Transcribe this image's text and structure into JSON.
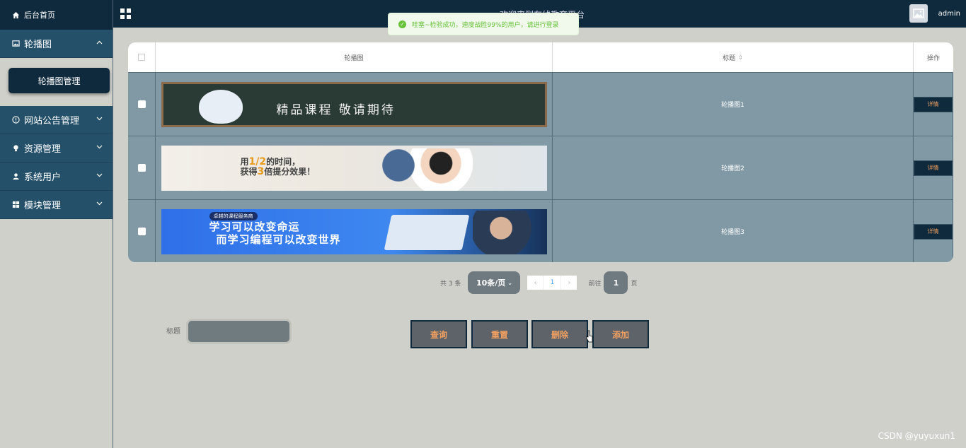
{
  "sidebar": {
    "home_label": "后台首页",
    "items": [
      {
        "label": "轮播图",
        "chevron": "^"
      },
      {
        "label": "网站公告管理",
        "chevron": "v"
      },
      {
        "label": "资源管理",
        "chevron": "v"
      },
      {
        "label": "系统用户",
        "chevron": "v"
      },
      {
        "label": "模块管理",
        "chevron": "v"
      }
    ],
    "submenu_label": "轮播图管理"
  },
  "topbar": {
    "title": "欢迎来到在线教育平台",
    "username": "admin"
  },
  "toast": {
    "message": "哇塞~检验成功，速度战胜99%的用户，请进行登录"
  },
  "table": {
    "headers": [
      "轮播图",
      "标题",
      "操作"
    ],
    "rows": [
      {
        "title": "轮播图1",
        "action": "详情",
        "banner_text": "精品课程 敬请期待"
      },
      {
        "title": "轮播图2",
        "action": "详情",
        "banner_line1_a": "用",
        "banner_line1_hl": "1/2",
        "banner_line1_b": "的时间，",
        "banner_line2_a": "获得",
        "banner_line2_hl": "3",
        "banner_line2_b": "倍提分效果！"
      },
      {
        "title": "轮播图3",
        "action": "详情",
        "banner_tag": "卓越的课程服务商",
        "banner_line1": "学习可以改变命运",
        "banner_line2": "而学习编程可以改变世界"
      }
    ]
  },
  "pagination": {
    "total": "共 3 条",
    "page_size": "10条/页",
    "prev": "‹",
    "current_page": "1",
    "next": "›",
    "goto_label": "前往",
    "goto_value": "1",
    "page_suffix": "页"
  },
  "search": {
    "label": "标题",
    "placeholder": ""
  },
  "actions": {
    "query": "查询",
    "reset": "重置",
    "delete": "删除",
    "add": "添加"
  },
  "watermark": "CSDN @yuyuxun1",
  "colors": {
    "sidebar_dark": "#102a3d",
    "sidebar_item": "#24506a",
    "table_row": "#8099a5",
    "action_text": "#f2a060",
    "toast_green": "#67c23a"
  }
}
